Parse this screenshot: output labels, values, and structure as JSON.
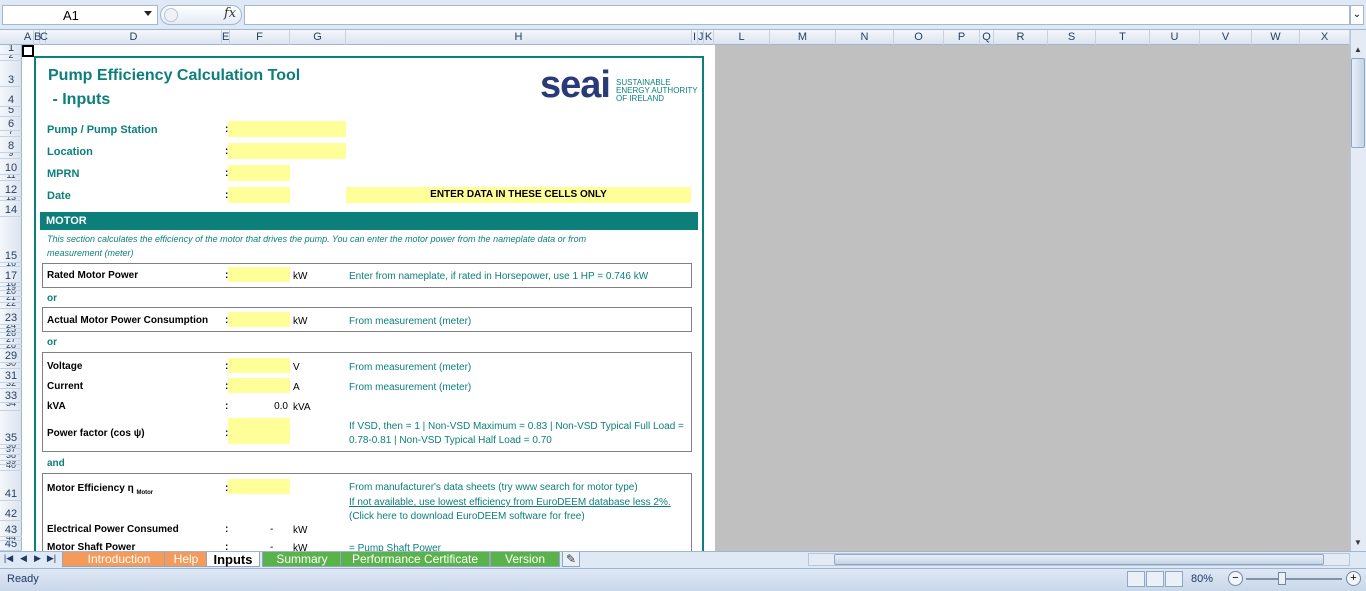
{
  "formula_bar": {
    "cell_ref": "A1",
    "fx": "fx",
    "value": ""
  },
  "columns": [
    "A",
    "B",
    "C",
    "D",
    "E",
    "F",
    "G",
    "H",
    "I",
    "J",
    "K",
    "L",
    "M",
    "N",
    "O",
    "P",
    "Q",
    "R",
    "S",
    "T",
    "U",
    "V",
    "W",
    "X"
  ],
  "rows": [
    "1",
    "2",
    "3",
    "4",
    "5",
    "6",
    "7",
    "8",
    "9",
    "10",
    "11",
    "12",
    "13",
    "14",
    "15",
    "16",
    "17",
    "18",
    "19",
    "20",
    "21",
    "22",
    "23",
    "24",
    "25",
    "26",
    "27",
    "28",
    "29",
    "30",
    "31",
    "32",
    "33",
    "34",
    "35",
    "36",
    "37",
    "38",
    "39",
    "40",
    "41",
    "42",
    "43",
    "44",
    "45"
  ],
  "sheet": {
    "title_line1": "Pump Efficiency Calculation Tool",
    "title_line2": " - Inputs",
    "logo": {
      "name": "seai",
      "sub": "SUSTAINABLE ENERGY AUTHORITY OF IRELAND"
    },
    "fields": {
      "pump_station": "Pump / Pump Station",
      "location": "Location",
      "mprn": "MPRN",
      "date": "Date",
      "colon": ":"
    },
    "enter_data_banner": "ENTER DATA IN THESE CELLS ONLY",
    "motor": {
      "header": "MOTOR",
      "intro_line1": "This section calculates the efficiency of the motor that drives the pump.  You can enter the motor power from the nameplate data or from",
      "intro_line2": "measurement (meter)",
      "rated_power": "Rated Motor Power",
      "rated_unit": "kW",
      "rated_note": "Enter from nameplate, if rated in Horsepower, use 1 HP = 0.746 kW",
      "or1": "or",
      "actual_power": "Actual Motor Power Consumption",
      "actual_unit": "kW",
      "actual_note": "From measurement (meter)",
      "or2": "or",
      "voltage": "Voltage",
      "voltage_unit": "V",
      "voltage_note": "From measurement (meter)",
      "current": "Current",
      "current_unit": "A",
      "current_note": "From measurement (meter)",
      "kva": "kVA",
      "kva_value": "0.0",
      "kva_unit": "kVA",
      "pf": "Power factor  (cos ψ)",
      "pf_note1": "If VSD, then = 1 | Non-VSD Maximum = 0.83 | Non-VSD Typical Full Load =",
      "pf_note2": "0.78-0.81 | Non-VSD Typical Half Load = 0.70",
      "and": "and",
      "eff": "Motor Efficiency η",
      "eff_sub": "Motor",
      "eff_note1": "From manufacturer's data sheets (try www search for motor type)",
      "eff_note2": "If not available, use lowest efficiency from EuroDEEM database less 2%.",
      "eff_note3": "(Click here to download EuroDEEM software for free)",
      "elec_power": "Electrical Power Consumed",
      "elec_value": "-",
      "elec_unit": "kW",
      "shaft_power": "Motor Shaft Power",
      "shaft_value": "-",
      "shaft_unit": "kW",
      "shaft_note": "= Pump Shaft Power"
    }
  },
  "tabs": [
    {
      "label": "Introduction",
      "style": "orange"
    },
    {
      "label": "Help",
      "style": "orange"
    },
    {
      "label": "Inputs",
      "style": "active"
    },
    {
      "label": "Summary",
      "style": "green"
    },
    {
      "label": "Performance Certificate",
      "style": "green"
    },
    {
      "label": "Version",
      "style": "green"
    }
  ],
  "status": {
    "text": "Ready",
    "zoom": "80%",
    "zoom_minus": "−",
    "zoom_plus": "+"
  },
  "colors": {
    "teal": "#0c7f7a",
    "input_yellow": "#ffff99",
    "brand_navy": "#2a3a78"
  }
}
